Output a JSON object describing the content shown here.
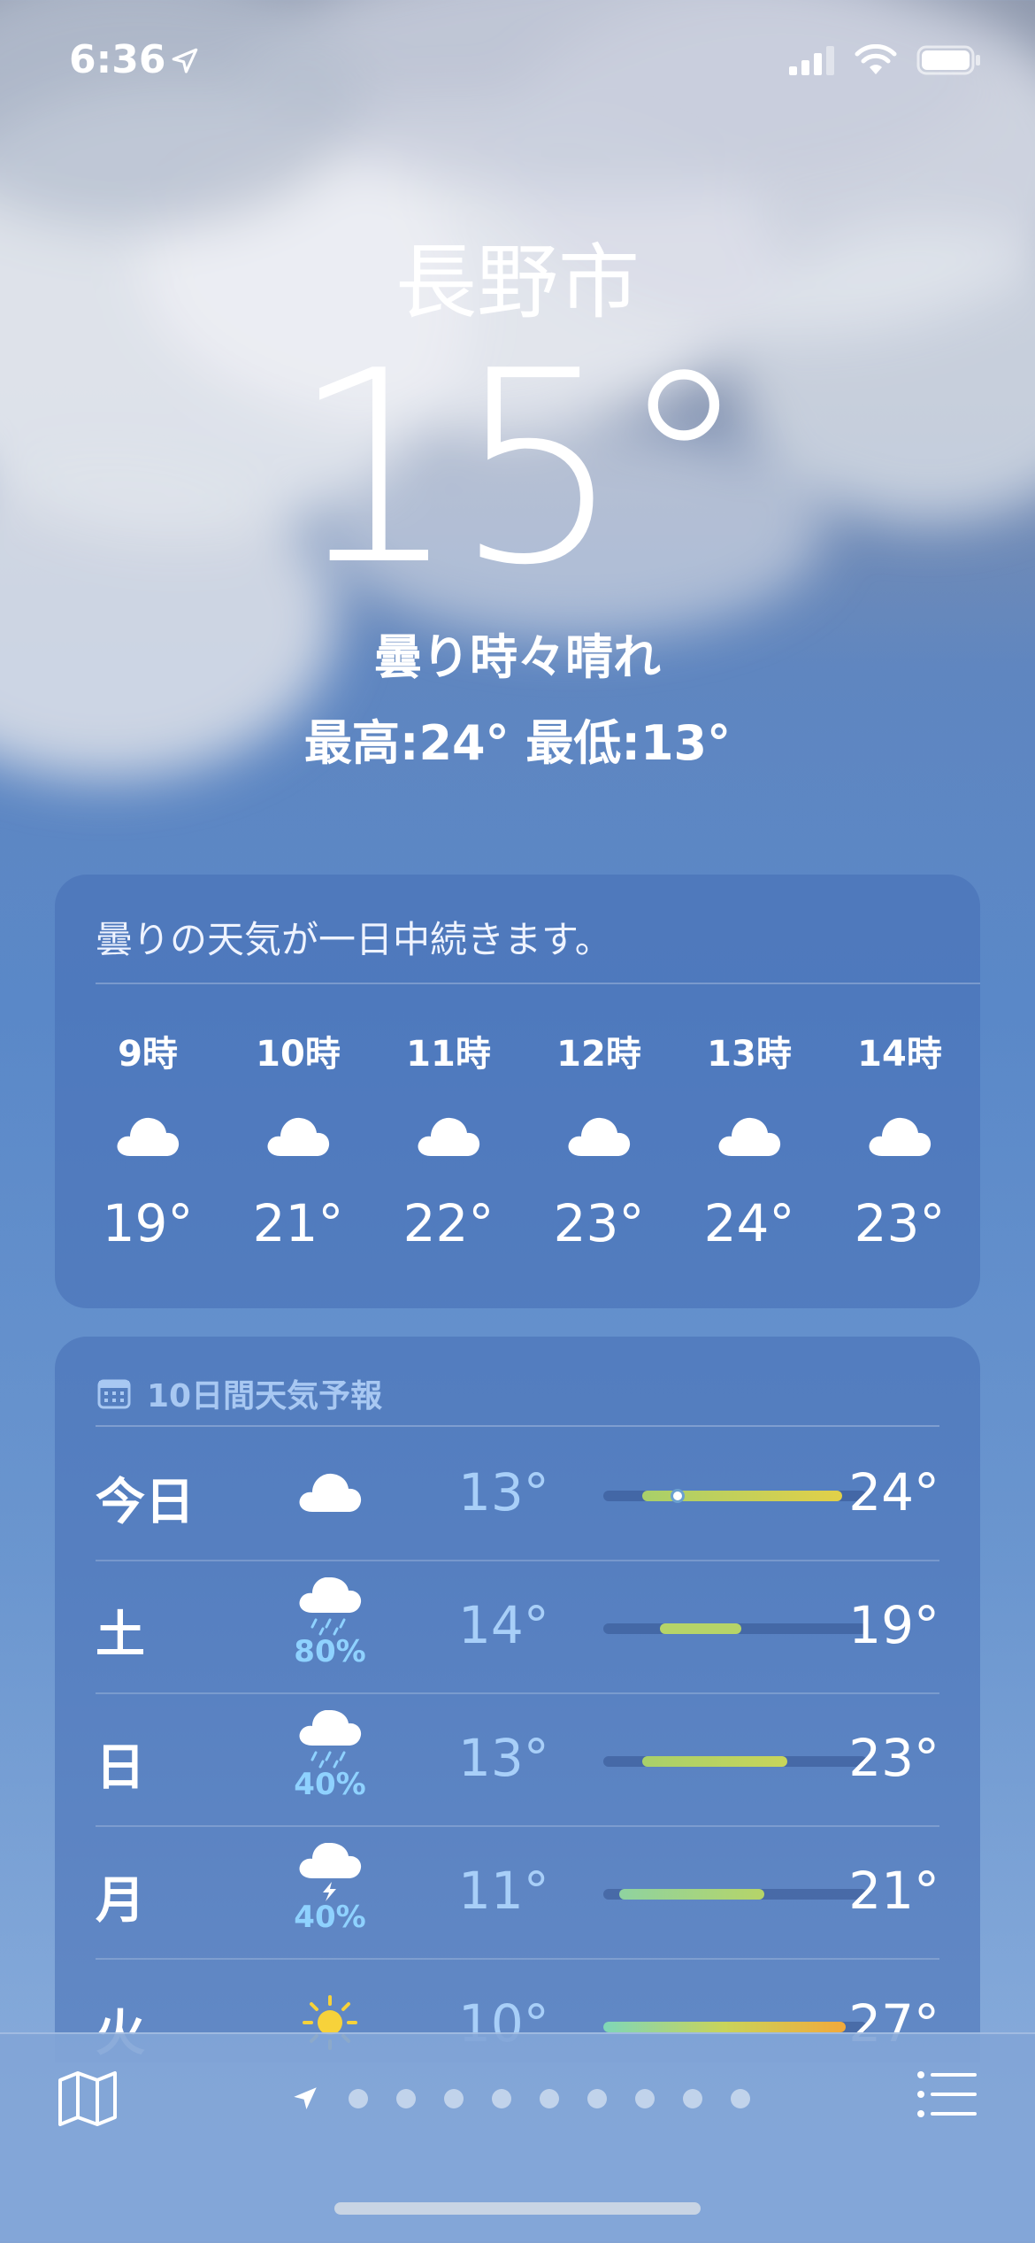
{
  "status_bar": {
    "time": "6:36"
  },
  "header": {
    "city": "長野市",
    "temperature": "15°",
    "condition": "曇り時々晴れ",
    "high_low": "最高:24°  最低:13°"
  },
  "hourly": {
    "summary": "曇りの天気が一日中続きます。",
    "hours": [
      {
        "time": "9時",
        "icon": "cloud-icon",
        "temp": "19°"
      },
      {
        "time": "10時",
        "icon": "cloud-icon",
        "temp": "21°"
      },
      {
        "time": "11時",
        "icon": "cloud-icon",
        "temp": "22°"
      },
      {
        "time": "12時",
        "icon": "cloud-icon",
        "temp": "23°"
      },
      {
        "time": "13時",
        "icon": "cloud-icon",
        "temp": "24°"
      },
      {
        "time": "14時",
        "icon": "cloud-icon",
        "temp": "23°"
      }
    ]
  },
  "daily": {
    "title": "10日間天気予報",
    "days": [
      {
        "day": "今日",
        "icon": "cloud-icon",
        "pop": "",
        "low": "13°",
        "high": "24°"
      },
      {
        "day": "土",
        "icon": "cloud-rain-icon",
        "pop": "80%",
        "low": "14°",
        "high": "19°"
      },
      {
        "day": "日",
        "icon": "cloud-rain-icon",
        "pop": "40%",
        "low": "13°",
        "high": "23°"
      },
      {
        "day": "月",
        "icon": "cloud-bolt-icon",
        "pop": "40%",
        "low": "11°",
        "high": "21°"
      },
      {
        "day": "火",
        "icon": "sun-icon",
        "pop": "",
        "low": "10°",
        "high": "27°"
      }
    ]
  },
  "colors": {
    "range_green": "#a8d06a",
    "range_yellow": "#e2d048",
    "range_orange": "#f2a93b",
    "pop_blue": "#8fd2ff"
  }
}
